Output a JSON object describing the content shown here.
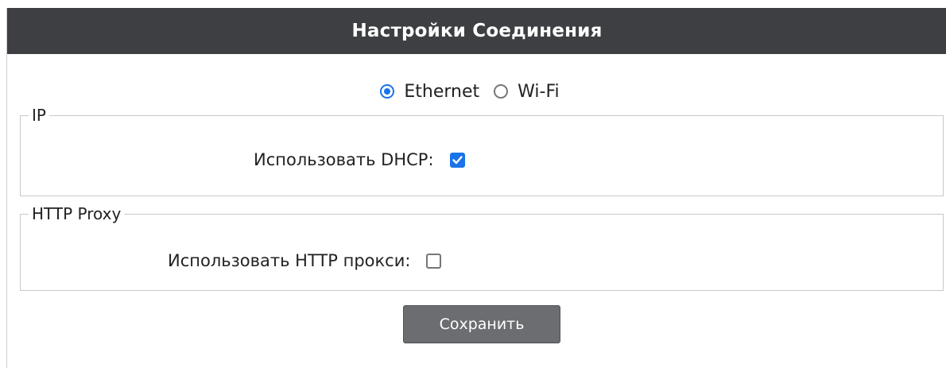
{
  "header": {
    "title": "Настройки Соединения"
  },
  "connection_mode": {
    "options": [
      {
        "label": "Ethernet",
        "selected": true
      },
      {
        "label": "Wi-Fi",
        "selected": false
      }
    ]
  },
  "ip_section": {
    "legend": "IP",
    "dhcp_label": "Использовать DHCP:",
    "dhcp_checked": true
  },
  "proxy_section": {
    "legend": "HTTP Proxy",
    "proxy_label": "Использовать HTTP прокси:",
    "proxy_checked": false
  },
  "actions": {
    "save_label": "Сохранить"
  },
  "colors": {
    "header_bg": "#3d3f42",
    "accent": "#1a73e8",
    "button_bg": "#6b6d70"
  }
}
